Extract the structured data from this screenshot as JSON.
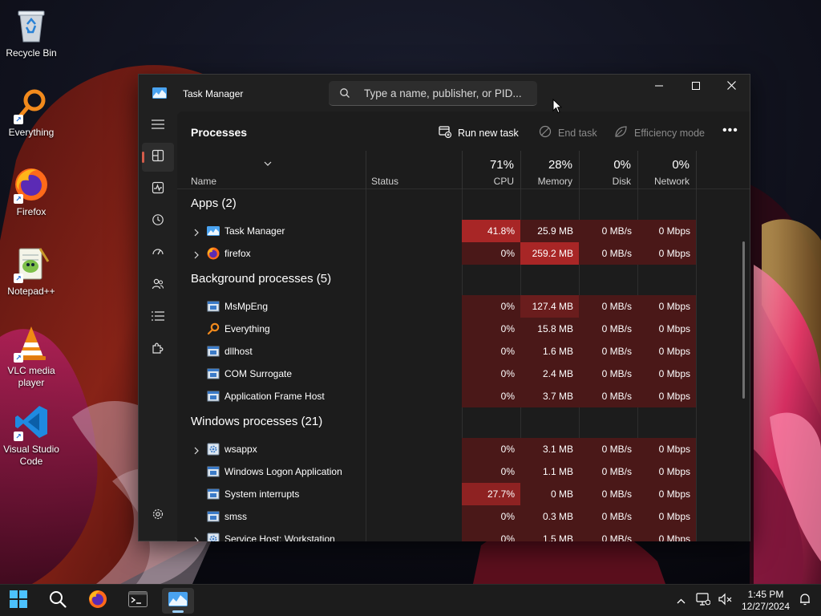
{
  "desktop": {
    "icons": [
      {
        "label": "Recycle Bin",
        "icon": "recycle-bin-icon"
      },
      {
        "label": "Everything",
        "icon": "everything-search-icon"
      },
      {
        "label": "Firefox",
        "icon": "firefox-icon"
      },
      {
        "label": "Notepad++",
        "icon": "notepadpp-icon"
      },
      {
        "label": "VLC media player",
        "icon": "vlc-icon"
      },
      {
        "label": "Visual Studio Code",
        "icon": "vscode-icon"
      }
    ]
  },
  "window": {
    "title": "Task Manager",
    "search_placeholder": "Type a name, publisher, or PID...",
    "page_title": "Processes",
    "commands": {
      "run_new_task": "Run new task",
      "end_task": "End task",
      "efficiency_mode": "Efficiency mode",
      "more": "•••"
    },
    "nav": [
      "processes",
      "performance",
      "app-history",
      "startup-apps",
      "users",
      "details",
      "services",
      "settings"
    ]
  },
  "columns": {
    "name": "Name",
    "status": "Status",
    "cpu": {
      "pct": "71%",
      "label": "CPU"
    },
    "memory": {
      "pct": "28%",
      "label": "Memory"
    },
    "disk": {
      "pct": "0%",
      "label": "Disk"
    },
    "network": {
      "pct": "0%",
      "label": "Network"
    }
  },
  "groups": {
    "apps": "Apps (2)",
    "background": "Background processes (5)",
    "windows": "Windows processes (21)"
  },
  "processes": [
    {
      "name": "Task Manager",
      "cpu": "41.8%",
      "memory": "25.9 MB",
      "disk": "0 MB/s",
      "network": "0 Mbps"
    },
    {
      "name": "firefox",
      "cpu": "0%",
      "memory": "259.2 MB",
      "disk": "0 MB/s",
      "network": "0 Mbps"
    },
    {
      "name": "MsMpEng",
      "cpu": "0%",
      "memory": "127.4 MB",
      "disk": "0 MB/s",
      "network": "0 Mbps"
    },
    {
      "name": "Everything",
      "cpu": "0%",
      "memory": "15.8 MB",
      "disk": "0 MB/s",
      "network": "0 Mbps"
    },
    {
      "name": "dllhost",
      "cpu": "0%",
      "memory": "1.6 MB",
      "disk": "0 MB/s",
      "network": "0 Mbps"
    },
    {
      "name": "COM Surrogate",
      "cpu": "0%",
      "memory": "2.4 MB",
      "disk": "0 MB/s",
      "network": "0 Mbps"
    },
    {
      "name": "Application Frame Host",
      "cpu": "0%",
      "memory": "3.7 MB",
      "disk": "0 MB/s",
      "network": "0 Mbps"
    },
    {
      "name": "wsappx",
      "cpu": "0%",
      "memory": "3.1 MB",
      "disk": "0 MB/s",
      "network": "0 Mbps"
    },
    {
      "name": "Windows Logon Application",
      "cpu": "0%",
      "memory": "1.1 MB",
      "disk": "0 MB/s",
      "network": "0 Mbps"
    },
    {
      "name": "System interrupts",
      "cpu": "27.7%",
      "memory": "0 MB",
      "disk": "0 MB/s",
      "network": "0 Mbps"
    },
    {
      "name": "smss",
      "cpu": "0%",
      "memory": "0.3 MB",
      "disk": "0 MB/s",
      "network": "0 Mbps"
    },
    {
      "name": "Service Host: Workstation",
      "cpu": "0%",
      "memory": "1.5 MB",
      "disk": "0 MB/s",
      "network": "0 Mbps"
    }
  ],
  "heat_colors": {
    "low": "#4a1818",
    "mid": "#6a1d1d",
    "high": "#a82626",
    "accent": "#d35c4a"
  },
  "taskbar": {
    "apps": [
      "start-icon",
      "search-icon",
      "firefox-icon",
      "terminal-icon",
      "task-manager-icon"
    ],
    "time": "1:45 PM",
    "date": "12/27/2024"
  }
}
